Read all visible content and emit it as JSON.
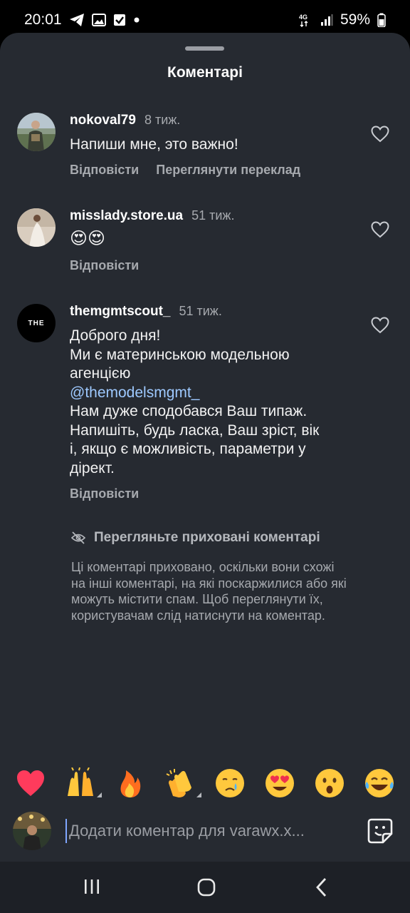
{
  "status_bar": {
    "time": "20:01",
    "left_icons": [
      "telegram-icon",
      "gallery-icon",
      "checkbox-icon",
      "dot-icon"
    ],
    "network": "4G",
    "battery": "59%"
  },
  "sheet": {
    "title": "Коментарі"
  },
  "comments": [
    {
      "username": "nokoval79",
      "time": "8 тиж.",
      "lines": [
        "Напиши мне, это важно!"
      ],
      "actions": [
        "Відповісти",
        "Переглянути переклад"
      ]
    },
    {
      "username": "misslady.store.ua",
      "time": "51 тиж.",
      "emoji": "😍😍",
      "actions": [
        "Відповісти"
      ]
    },
    {
      "username": "themgmtscout_",
      "time": "51 тиж.",
      "avatar_text": "THE",
      "lines": [
        "Доброго дня!",
        "Ми є материнською модельною",
        "агенцією",
        "@themodelsmgmt_",
        "Нам дуже сподобався Ваш типаж.",
        "Напишіть, будь ласка, Ваш зріст, вік",
        "і, якщо є можливість, параметри у",
        "дірект."
      ],
      "actions": [
        "Відповісти"
      ]
    }
  ],
  "hidden": {
    "title": "Перегляньте приховані коментарі",
    "description_lines": [
      "Ці коментарі приховано, оскільки вони схожі",
      "на інші коментарі, на які поскаржилися або які",
      "можуть містити спам. Щоб переглянути їх,",
      "користувачам слід натиснути на коментар."
    ]
  },
  "reactions": [
    "❤️",
    "🙌",
    "🔥",
    "👏",
    "😢",
    "😍",
    "😮",
    "😂"
  ],
  "composer": {
    "placeholder": "Додати коментар для varawx.x..."
  },
  "colors": {
    "sheet_bg": "#262a31",
    "muted_text": "#a6a9ae",
    "mention": "#9ec9ff",
    "navbar_bg": "#1d2026"
  }
}
